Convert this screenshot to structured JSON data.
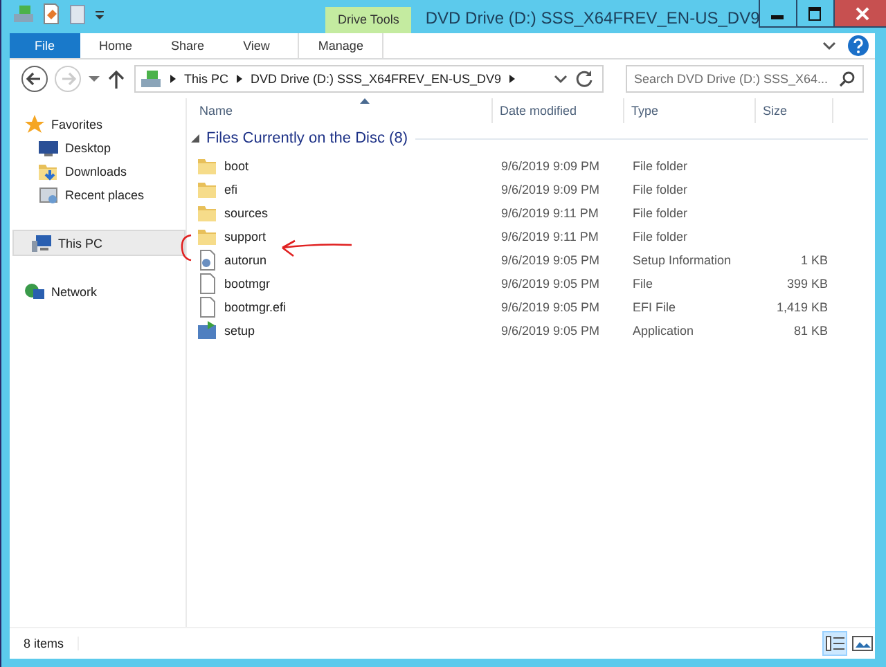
{
  "window": {
    "title": "DVD Drive (D:) SSS_X64FREV_EN-US_DV9",
    "context_group": "Drive Tools"
  },
  "ribbon": {
    "tabs": [
      {
        "label": "File",
        "kind": "file",
        "selected": false
      },
      {
        "label": "Home",
        "kind": "tab",
        "selected": false
      },
      {
        "label": "Share",
        "kind": "tab",
        "selected": false
      },
      {
        "label": "View",
        "kind": "tab",
        "selected": false
      },
      {
        "label": "Manage",
        "kind": "context",
        "selected": false
      }
    ]
  },
  "address": {
    "crumbs": [
      "This PC",
      "DVD Drive (D:) SSS_X64FREV_EN-US_DV9"
    ],
    "search_placeholder": "Search DVD Drive (D:) SSS_X64..."
  },
  "sidebar": {
    "items": [
      {
        "label": "Favorites",
        "kind": "star",
        "selected": false,
        "children": [
          {
            "label": "Desktop",
            "kind": "desktop",
            "selected": false
          },
          {
            "label": "Downloads",
            "kind": "downloads",
            "selected": false
          },
          {
            "label": "Recent places",
            "kind": "recent",
            "selected": false
          }
        ]
      },
      {
        "label": "This PC",
        "kind": "pc",
        "selected": true
      },
      {
        "label": "Network",
        "kind": "network",
        "selected": false
      }
    ]
  },
  "table": {
    "columns": [
      "Name",
      "Date modified",
      "Type",
      "Size"
    ],
    "group": "Files Currently on the Disc (8)",
    "rows": [
      {
        "kind": "folder",
        "name": "boot",
        "date": "9/6/2019 9:09 PM",
        "type": "File folder"
      },
      {
        "kind": "folder",
        "name": "efi",
        "date": "9/6/2019 9:09 PM",
        "type": "File folder"
      },
      {
        "kind": "folder",
        "name": "sources",
        "date": "9/6/2019 9:11 PM",
        "type": "File folder"
      },
      {
        "kind": "folder",
        "name": "support",
        "date": "9/6/2019 9:11 PM",
        "type": "File folder"
      },
      {
        "kind": "settings",
        "name": "autorun",
        "date": "9/6/2019 9:05 PM",
        "type": "Setup Information",
        "size": "1 KB"
      },
      {
        "kind": "file",
        "name": "bootmgr",
        "date": "9/6/2019 9:05 PM",
        "type": "File",
        "size": "399 KB"
      },
      {
        "kind": "file",
        "name": "bootmgr.efi",
        "date": "9/6/2019 9:05 PM",
        "type": "EFI File",
        "size": "1,419 KB"
      },
      {
        "kind": "app",
        "name": "setup",
        "date": "9/6/2019 9:05 PM",
        "type": "Application",
        "size": "81 KB"
      }
    ]
  },
  "status_bar": {
    "text": "8 items",
    "views": [
      {
        "kind": "details",
        "selected": true
      },
      {
        "kind": "tiles",
        "selected": false
      }
    ]
  }
}
